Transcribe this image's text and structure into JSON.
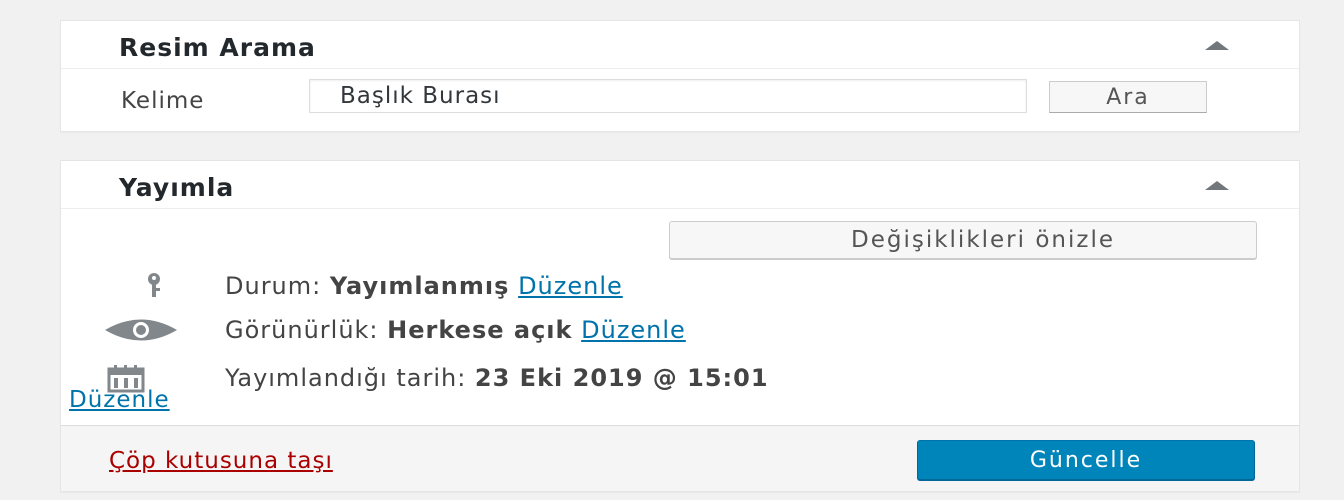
{
  "search_box": {
    "title": "Resim Arama",
    "label": "Kelime",
    "input_value": "Başlık Burası",
    "button_label": "Ara"
  },
  "publish_box": {
    "title": "Yayımla",
    "preview_button": "Değişiklikleri önizle",
    "status": {
      "icon": "key-icon",
      "label": "Durum:",
      "value": "Yayımlanmış",
      "edit": "Düzenle"
    },
    "visibility": {
      "icon": "eye-icon",
      "label": "Görünürlük:",
      "value": "Herkese açık",
      "edit": "Düzenle"
    },
    "date": {
      "icon": "calendar-icon",
      "label": "Yayımlandığı tarih:",
      "value": "23 Eki 2019 @ 15:01",
      "edit": "Düzenle"
    },
    "trash_link": "Çöp kutusuna taşı",
    "update_button": "Güncelle"
  },
  "colors": {
    "accent": "#0085ba",
    "link": "#0073aa",
    "trash": "#a00000",
    "background": "#f1f1f1"
  }
}
